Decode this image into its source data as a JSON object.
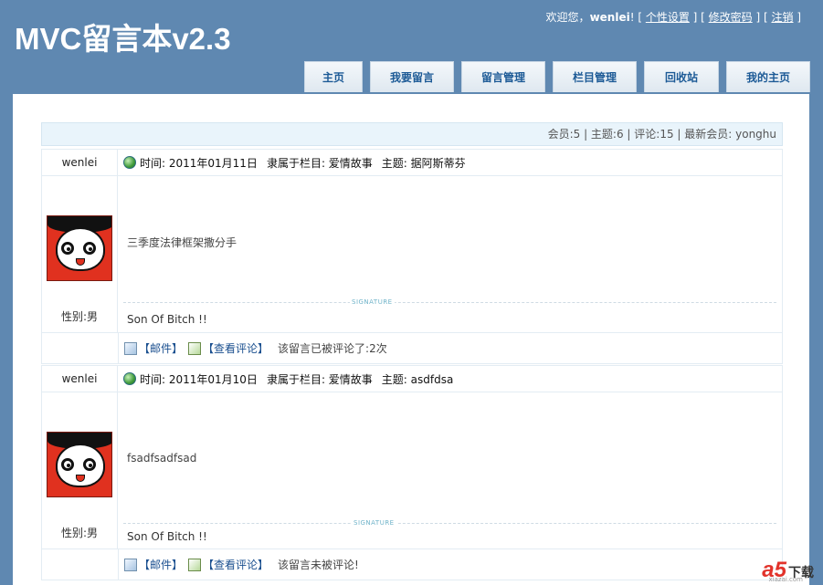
{
  "header": {
    "logo": "MVC留言本v2.3",
    "welcome_prefix": "欢迎您，",
    "username": "wenlei",
    "welcome_suffix": "! [ ",
    "links": [
      "个性设置",
      "修改密码",
      "注销"
    ],
    "sep1": " ] [ ",
    "sep2": " ] [ ",
    "end": " ]"
  },
  "nav": {
    "tabs": [
      "主页",
      "我要留言",
      "留言管理",
      "栏目管理",
      "回收站",
      "我的主页"
    ]
  },
  "stats": "会员:5 |  主题:6 |  评论:15 |  最新会员: yonghu",
  "posts": [
    {
      "author": "wenlei",
      "time": "时间: 2011年01月11日",
      "category": "隶属于栏目: 爱情故事",
      "subject": "主题: 据阿斯蒂芬",
      "content": "三季度法律框架撒分手",
      "gender": "性别:男",
      "signature_label": "SIGNATURE",
      "signature": "Son Of Bitch !!",
      "mail": "【邮件】",
      "comments_link": "【查看评论】",
      "comment_note": "该留言已被评论了:2次"
    },
    {
      "author": "wenlei",
      "time": "时间: 2011年01月10日",
      "category": "隶属于栏目: 爱情故事",
      "subject": "主题: asdfdsa",
      "content": "fsadfsadfsad",
      "gender": "性别:男",
      "signature_label": "SIGNATURE",
      "signature": "Son Of Bitch !!",
      "mail": "【邮件】",
      "comments_link": "【查看评论】",
      "comment_note": "该留言未被评论!"
    }
  ],
  "watermark": {
    "brand": "a5",
    "text": "下载",
    "site": "xiazai.com"
  }
}
